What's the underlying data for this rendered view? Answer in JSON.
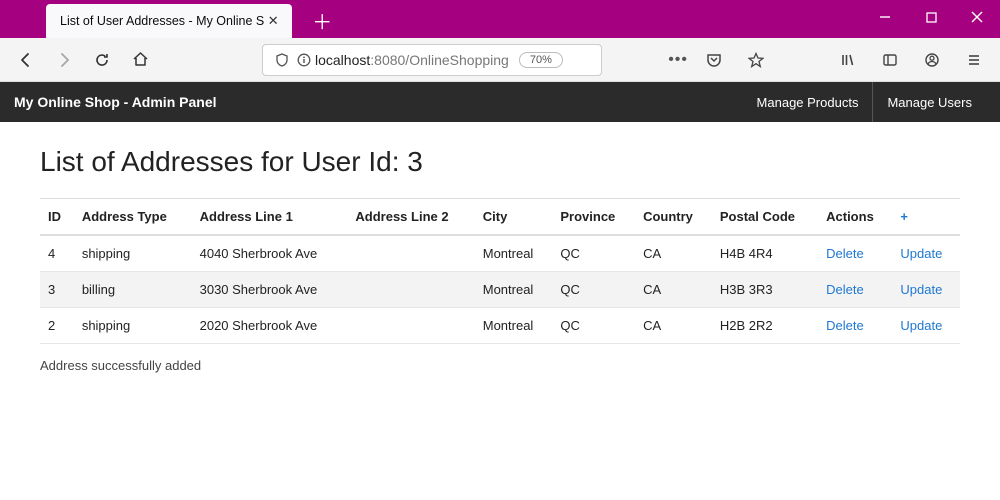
{
  "browser": {
    "tab_title": "List of User Addresses - My Online S",
    "url_host": "localhost",
    "url_rest": ":8080/OnlineShopping",
    "zoom": "70%"
  },
  "appbar": {
    "title": "My Online Shop - Admin Panel",
    "nav": [
      "Manage Products",
      "Manage Users"
    ]
  },
  "page": {
    "heading": "List of Addresses for User Id: 3",
    "status": "Address successfully added"
  },
  "table": {
    "headers": [
      "ID",
      "Address Type",
      "Address Line 1",
      "Address Line 2",
      "City",
      "Province",
      "Country",
      "Postal Code",
      "Actions"
    ],
    "add_icon": "+",
    "action_labels": {
      "delete": "Delete",
      "update": "Update"
    },
    "rows": [
      {
        "id": "4",
        "type": "shipping",
        "line1": "4040 Sherbrook Ave",
        "line2": "",
        "city": "Montreal",
        "province": "QC",
        "country": "CA",
        "postal": "H4B 4R4"
      },
      {
        "id": "3",
        "type": "billing",
        "line1": "3030 Sherbrook Ave",
        "line2": "",
        "city": "Montreal",
        "province": "QC",
        "country": "CA",
        "postal": "H3B 3R3"
      },
      {
        "id": "2",
        "type": "shipping",
        "line1": "2020 Sherbrook Ave",
        "line2": "",
        "city": "Montreal",
        "province": "QC",
        "country": "CA",
        "postal": "H2B 2R2"
      }
    ]
  }
}
